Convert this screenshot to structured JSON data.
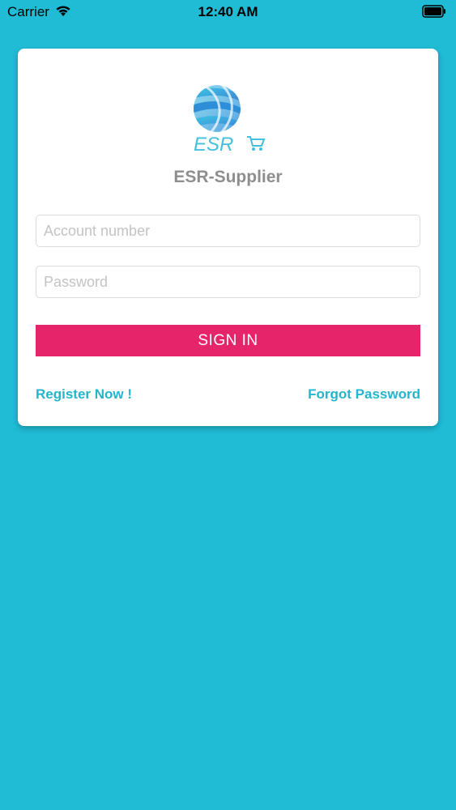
{
  "status_bar": {
    "carrier": "Carrier",
    "time": "12:40 AM"
  },
  "login": {
    "app_name": "ESR-Supplier",
    "logo_text": "ESR",
    "account_placeholder": "Account number",
    "password_placeholder": "Password",
    "sign_in_label": "SIGN IN",
    "register_label": "Register Now !",
    "forgot_label": "Forgot Password"
  },
  "colors": {
    "background": "#20bcd6",
    "primary_button": "#e6246a",
    "link": "#24b5cc",
    "title": "#8e8e8e"
  },
  "icons": {
    "wifi": "wifi-icon",
    "battery": "battery-icon",
    "logo_globe": "globe-logo-icon",
    "cart": "cart-icon"
  }
}
